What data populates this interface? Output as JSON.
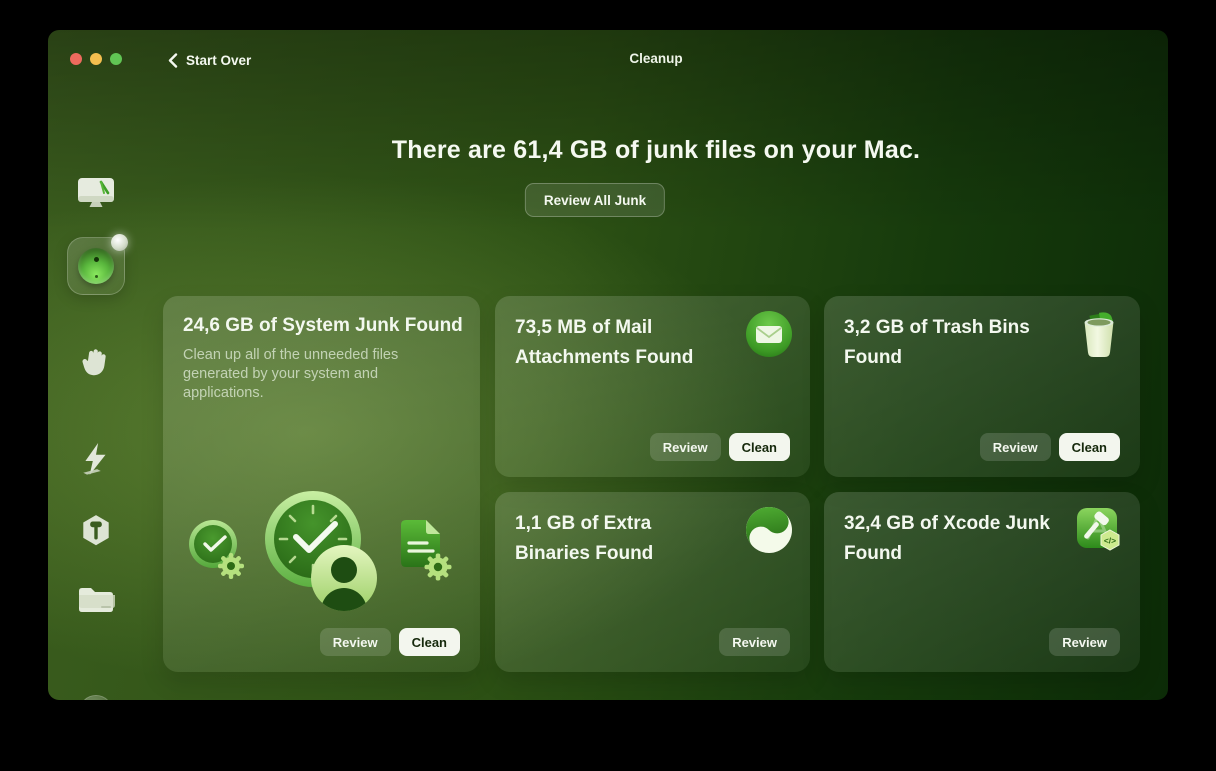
{
  "window": {
    "title": "Cleanup",
    "back_label": "Start Over",
    "traffic_lights": [
      "close",
      "minimize",
      "zoom"
    ]
  },
  "sidebar": {
    "items": [
      {
        "id": "smart-care",
        "icon": "display-icon",
        "selected": false
      },
      {
        "id": "cleanup",
        "icon": "cleanup-ball-icon",
        "selected": true,
        "notification": true
      },
      {
        "id": "protection",
        "icon": "hand-icon",
        "selected": false
      },
      {
        "id": "performance",
        "icon": "lightning-icon",
        "selected": false
      },
      {
        "id": "applications",
        "icon": "hexagon-hammer-icon",
        "selected": false
      },
      {
        "id": "files",
        "icon": "folder-icon",
        "selected": false
      },
      {
        "id": "assistant",
        "icon": "assistant-dots-icon",
        "selected": false
      }
    ]
  },
  "main": {
    "heading": "There are 61,4 GB of junk files on your Mac.",
    "review_all_label": "Review All Junk"
  },
  "cards": [
    {
      "title": "24,6 GB of System Junk Found",
      "size": "24,6 GB",
      "description": "Clean up all of the unneeded files generated by your system and applications.",
      "icon": "system-junk-clock-user-document-icons",
      "review_label": "Review",
      "clean_label": "Clean"
    },
    {
      "title": "73,5 MB of Mail Attachments Found",
      "size": "73,5 MB",
      "icon": "mail-envelope-circle-icon",
      "review_label": "Review",
      "clean_label": "Clean"
    },
    {
      "title": "3,2 GB of Trash Bins Found",
      "size": "3,2 GB",
      "icon": "trash-bin-icon",
      "review_label": "Review",
      "clean_label": "Clean"
    },
    {
      "title": "1,1 GB of Extra Binaries Found",
      "size": "1,1 GB",
      "icon": "yin-yang-swirl-icon",
      "review_label": "Review"
    },
    {
      "title": "32,4 GB of Xcode Junk Found",
      "size": "32,4 GB",
      "icon": "xcode-hammer-badge-icon",
      "review_label": "Review"
    }
  ],
  "colors": {
    "traffic_red": "#ee6a5e",
    "traffic_yellow": "#f4bf4f",
    "traffic_green": "#61c554",
    "background_dark_green": "#0c2b07",
    "background_light_green": "#4a6c27",
    "clean_button_bg": "#f3f6ee",
    "clean_button_text": "#16290c",
    "accent_green": "#58c93d"
  }
}
